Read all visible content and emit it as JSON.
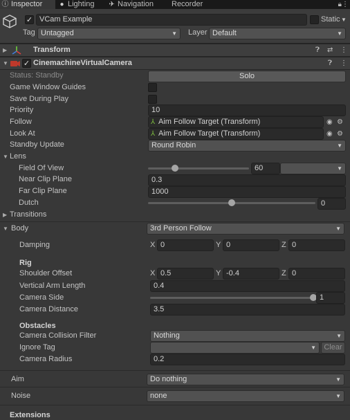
{
  "tabs": [
    {
      "label": "Inspector",
      "icon": "info-icon"
    },
    {
      "label": "Lighting",
      "icon": "bulb-icon"
    },
    {
      "label": "Navigation",
      "icon": "navigation-icon"
    },
    {
      "label": "Recorder",
      "icon": ""
    }
  ],
  "header": {
    "object_name": "VCam Example",
    "static_label": "Static",
    "tag_label": "Tag",
    "tag_value": "Untagged",
    "layer_label": "Layer",
    "layer_value": "Default"
  },
  "transform": {
    "title": "Transform"
  },
  "vcam": {
    "title": "CinemachineVirtualCamera",
    "status_label": "Status: Standby",
    "solo_label": "Solo",
    "game_window_guides": "Game Window Guides",
    "save_during_play": "Save During Play",
    "priority_label": "Priority",
    "priority_value": "10",
    "follow_label": "Follow",
    "follow_value": "Aim Follow Target (Transform)",
    "lookat_label": "Look At",
    "lookat_value": "Aim Follow Target (Transform)",
    "standby_label": "Standby Update",
    "standby_value": "Round Robin"
  },
  "lens": {
    "title": "Lens",
    "fov_label": "Field Of View",
    "fov_value": "60",
    "fov_fraction": 0.27,
    "near_label": "Near Clip Plane",
    "near_value": "0.3",
    "far_label": "Far Clip Plane",
    "far_value": "1000",
    "dutch_label": "Dutch",
    "dutch_value": "0",
    "dutch_fraction": 0.5
  },
  "transitions": {
    "title": "Transitions"
  },
  "body": {
    "title": "Body",
    "mode": "3rd Person Follow",
    "damping_label": "Damping",
    "damping": {
      "x": "0",
      "y": "0",
      "z": "0"
    },
    "rig_label": "Rig",
    "shoulder_label": "Shoulder Offset",
    "shoulder": {
      "x": "0.5",
      "y": "-0.4",
      "z": "0"
    },
    "arm_label": "Vertical Arm Length",
    "arm_value": "0.4",
    "side_label": "Camera Side",
    "side_value": "1",
    "side_fraction": 1.0,
    "distance_label": "Camera Distance",
    "distance_value": "3.5",
    "obstacles_label": "Obstacles",
    "collision_label": "Camera Collision Filter",
    "collision_value": "Nothing",
    "ignore_label": "Ignore Tag",
    "ignore_value": "",
    "clear_label": "Clear",
    "radius_label": "Camera Radius",
    "radius_value": "0.2"
  },
  "aim": {
    "title": "Aim",
    "value": "Do nothing"
  },
  "noise": {
    "title": "Noise",
    "value": "none"
  },
  "extensions": {
    "title": "Extensions"
  },
  "axis_labels": {
    "x": "X",
    "y": "Y",
    "z": "Z"
  },
  "colors": {
    "background": "#383838",
    "field": "#2a2a2a",
    "dropdown": "#515151",
    "tabbar": "#191919"
  }
}
